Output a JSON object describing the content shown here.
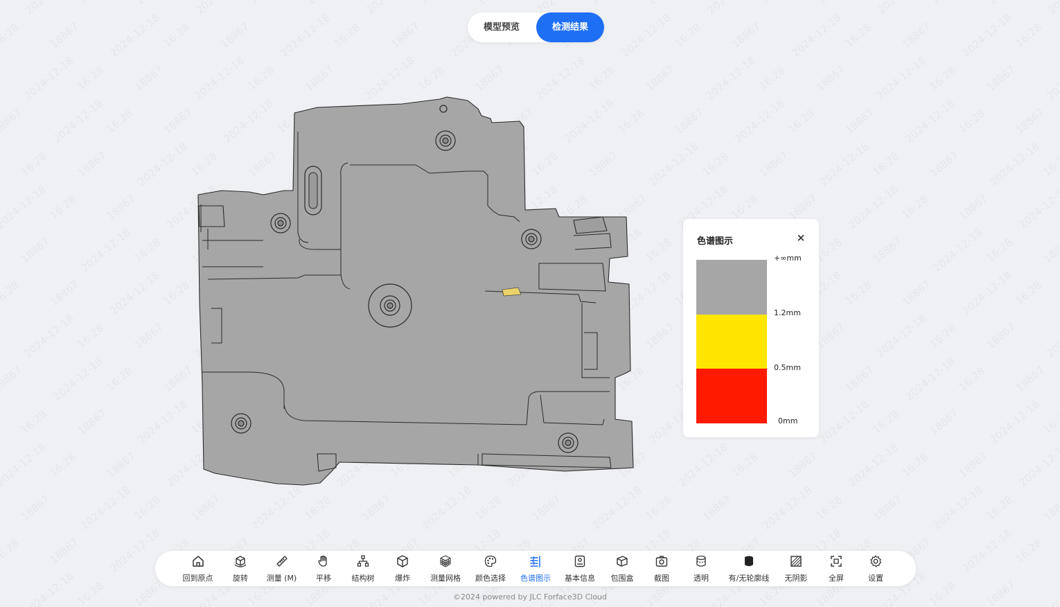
{
  "tabs": [
    {
      "label": "模型预览",
      "active": false
    },
    {
      "label": "检测结果",
      "active": true
    }
  ],
  "watermark": {
    "lines": [
      "18867",
      "2024-12-18",
      "16:28"
    ]
  },
  "legend": {
    "title": "色谱图示",
    "close_symbol": "×",
    "bands": [
      {
        "color": "#a6a6a6",
        "label": "+∞mm"
      },
      {
        "color": "#ffe600",
        "label": "1.2mm"
      },
      {
        "color": "#ff1a00",
        "label": "0.5mm"
      }
    ],
    "bottom_label": "0mm"
  },
  "toolbar": {
    "items": [
      {
        "label": "回到原点",
        "icon": "home-icon"
      },
      {
        "label": "旋转",
        "icon": "rotate-cube-icon"
      },
      {
        "label": "测量 (M)",
        "icon": "ruler-icon"
      },
      {
        "label": "平移",
        "icon": "hand-icon"
      },
      {
        "label": "结构树",
        "icon": "tree-icon"
      },
      {
        "label": "爆炸",
        "icon": "explode-cube-icon"
      },
      {
        "label": "测量网格",
        "icon": "mesh-icon"
      },
      {
        "label": "颜色选择",
        "icon": "palette-icon"
      },
      {
        "label": "色谱图示",
        "icon": "spectrum-icon",
        "active": true
      },
      {
        "label": "基本信息",
        "icon": "info-icon"
      },
      {
        "label": "包围盒",
        "icon": "bounding-box-icon"
      },
      {
        "label": "截图",
        "icon": "camera-icon"
      },
      {
        "label": "透明",
        "icon": "transparent-icon"
      },
      {
        "label": "有/无轮廓线",
        "icon": "outline-icon"
      },
      {
        "label": "无阴影",
        "icon": "shadow-icon"
      },
      {
        "label": "全屏",
        "icon": "fullscreen-icon"
      },
      {
        "label": "设置",
        "icon": "gear-icon"
      }
    ]
  },
  "footer": {
    "text": "©2024 powered by JLC Forface3D Cloud"
  },
  "colors": {
    "accent": "#1f6ff5",
    "model": "#a6a6a6",
    "background": "#eef0f3"
  }
}
